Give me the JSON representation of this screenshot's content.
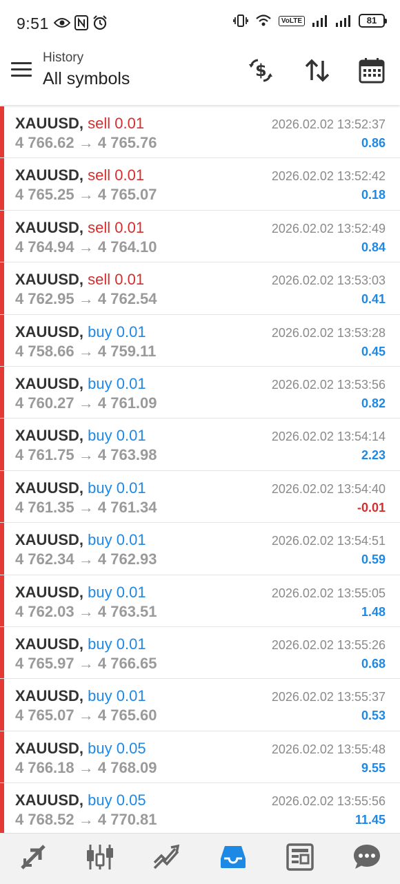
{
  "status_bar": {
    "time": "9:51",
    "volte": "VoLTE",
    "battery": "81"
  },
  "header": {
    "subtitle": "History",
    "title": "All symbols"
  },
  "colors": {
    "sell": "#d32f2f",
    "buy": "#1e88e5",
    "accent_bar": "#e53935",
    "nav_active": "#1e88e5"
  },
  "deals": [
    {
      "symbol": "XAUUSD",
      "type": "sell",
      "volume": "0.01",
      "open": "4 766.62",
      "close": "4 765.76",
      "time": "2026.02.02 13:52:37",
      "profit": "0.86"
    },
    {
      "symbol": "XAUUSD",
      "type": "sell",
      "volume": "0.01",
      "open": "4 765.25",
      "close": "4 765.07",
      "time": "2026.02.02 13:52:42",
      "profit": "0.18"
    },
    {
      "symbol": "XAUUSD",
      "type": "sell",
      "volume": "0.01",
      "open": "4 764.94",
      "close": "4 764.10",
      "time": "2026.02.02 13:52:49",
      "profit": "0.84"
    },
    {
      "symbol": "XAUUSD",
      "type": "sell",
      "volume": "0.01",
      "open": "4 762.95",
      "close": "4 762.54",
      "time": "2026.02.02 13:53:03",
      "profit": "0.41"
    },
    {
      "symbol": "XAUUSD",
      "type": "buy",
      "volume": "0.01",
      "open": "4 758.66",
      "close": "4 759.11",
      "time": "2026.02.02 13:53:28",
      "profit": "0.45"
    },
    {
      "symbol": "XAUUSD",
      "type": "buy",
      "volume": "0.01",
      "open": "4 760.27",
      "close": "4 761.09",
      "time": "2026.02.02 13:53:56",
      "profit": "0.82"
    },
    {
      "symbol": "XAUUSD",
      "type": "buy",
      "volume": "0.01",
      "open": "4 761.75",
      "close": "4 763.98",
      "time": "2026.02.02 13:54:14",
      "profit": "2.23"
    },
    {
      "symbol": "XAUUSD",
      "type": "buy",
      "volume": "0.01",
      "open": "4 761.35",
      "close": "4 761.34",
      "time": "2026.02.02 13:54:40",
      "profit": "-0.01"
    },
    {
      "symbol": "XAUUSD",
      "type": "buy",
      "volume": "0.01",
      "open": "4 762.34",
      "close": "4 762.93",
      "time": "2026.02.02 13:54:51",
      "profit": "0.59"
    },
    {
      "symbol": "XAUUSD",
      "type": "buy",
      "volume": "0.01",
      "open": "4 762.03",
      "close": "4 763.51",
      "time": "2026.02.02 13:55:05",
      "profit": "1.48"
    },
    {
      "symbol": "XAUUSD",
      "type": "buy",
      "volume": "0.01",
      "open": "4 765.97",
      "close": "4 766.65",
      "time": "2026.02.02 13:55:26",
      "profit": "0.68"
    },
    {
      "symbol": "XAUUSD",
      "type": "buy",
      "volume": "0.01",
      "open": "4 765.07",
      "close": "4 765.60",
      "time": "2026.02.02 13:55:37",
      "profit": "0.53"
    },
    {
      "symbol": "XAUUSD",
      "type": "buy",
      "volume": "0.05",
      "open": "4 766.18",
      "close": "4 768.09",
      "time": "2026.02.02 13:55:48",
      "profit": "9.55"
    },
    {
      "symbol": "XAUUSD",
      "type": "buy",
      "volume": "0.05",
      "open": "4 768.52",
      "close": "4 770.81",
      "time": "2026.02.02 13:55:56",
      "profit": "11.45"
    }
  ],
  "bottom_nav": [
    {
      "icon": "quotes-icon",
      "active": false
    },
    {
      "icon": "chart-icon",
      "active": false
    },
    {
      "icon": "trade-icon",
      "active": false
    },
    {
      "icon": "history-icon",
      "active": true
    },
    {
      "icon": "news-icon",
      "active": false
    },
    {
      "icon": "chat-icon",
      "active": false
    }
  ]
}
